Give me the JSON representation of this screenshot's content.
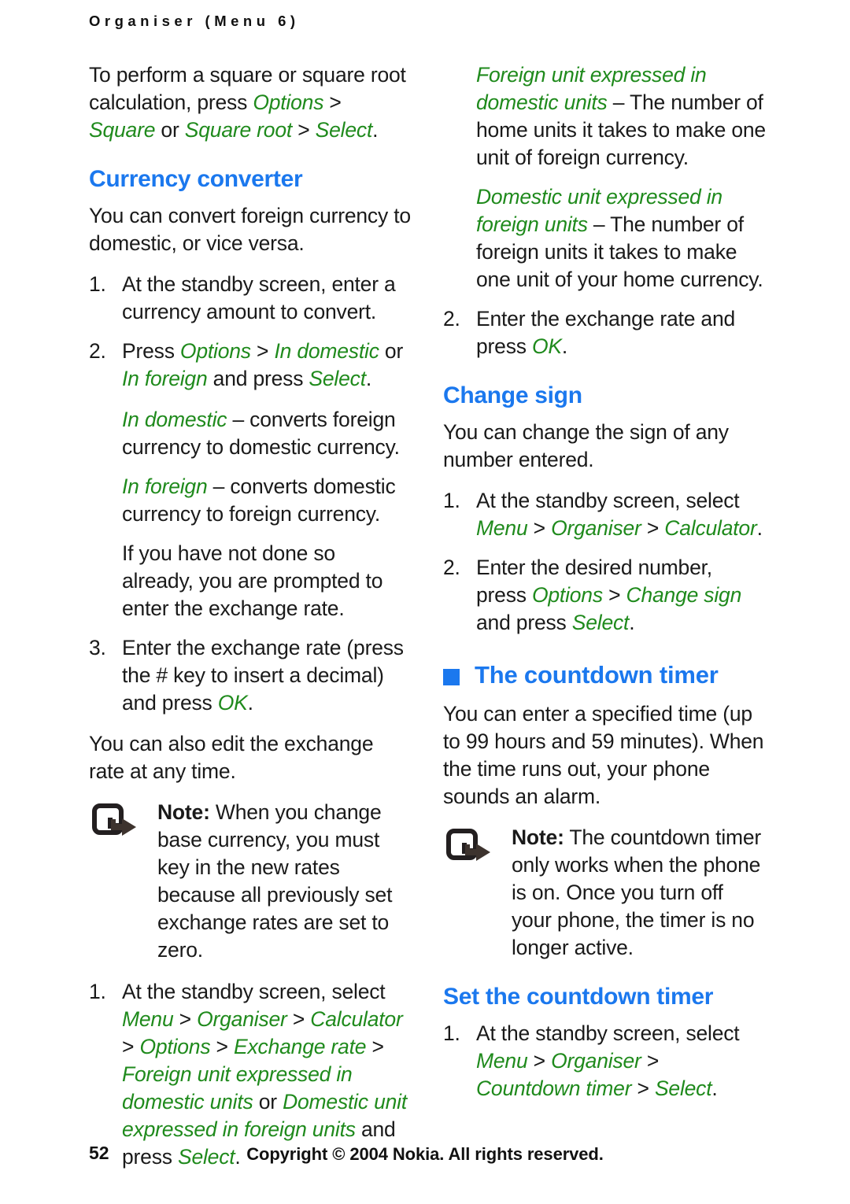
{
  "header": {
    "running_title": "Organiser (Menu 6)"
  },
  "colors": {
    "heading_blue": "#1b78ee",
    "ui_term_green": "#1f8a1c",
    "body_black": "#1a1a1a"
  },
  "left_column": {
    "intro_paragraph": {
      "t1": "To perform a square or square root calculation, press ",
      "ui1": "Options",
      "sep1": " > ",
      "ui2": "Square",
      "t2": " or ",
      "ui3": "Square root",
      "sep2": " > ",
      "ui4": "Select",
      "t3": "."
    },
    "currency_heading": "Currency converter",
    "currency_intro": "You can convert foreign currency to domestic, or vice versa.",
    "steps": {
      "s1_num": "1.",
      "s1_text": "At the standby screen, enter a currency amount to convert.",
      "s2_num": "2.",
      "s2_a": "Press ",
      "s2_ui1": "Options",
      "s2_sep1": " > ",
      "s2_ui2": "In domestic",
      "s2_b": " or ",
      "s2_ui3": "In foreign",
      "s2_c": " and press ",
      "s2_ui4": "Select",
      "s2_d": ".",
      "sub1_ui": "In domestic",
      "sub1_text": " – converts foreign currency to domestic currency.",
      "sub2_ui": "In foreign",
      "sub2_text": " – converts domestic currency to foreign currency.",
      "sub3_text": "If you have not done so already, you are prompted to enter the exchange rate.",
      "s3_num": "3.",
      "s3_a": "Enter the exchange rate (press the # key to insert a decimal) and press ",
      "s3_ui1": "OK",
      "s3_b": "."
    },
    "edit_rate_paragraph": "You can also edit the exchange rate at any time.",
    "note": {
      "icon": "note-pointer-icon",
      "label": "Note:",
      "text": " When you change base currency, you must key in the new rates because all previously set exchange rates are set to zero."
    },
    "exchange_steps": {
      "s1_num": "1.",
      "s1_a": "At the standby screen, select ",
      "s1_ui1": "Menu",
      "s1_sep1": " > ",
      "s1_ui2": "Organiser",
      "s1_sep2": " > ",
      "s1_ui3": "Calculator",
      "s1_sep3": " > ",
      "s1_ui4": "Options",
      "s1_sep4": " > ",
      "s1_ui5": "Exchange rate",
      "s1_sep5": " > ",
      "s1_ui6": "Foreign unit expressed in domestic units",
      "s1_b": " or ",
      "s1_ui7": "Domestic unit expressed in foreign units",
      "s1_c": " and press ",
      "s1_ui8": "Select",
      "s1_d": "."
    }
  },
  "right_column": {
    "def1_ui": "Foreign unit expressed in domestic units",
    "def1_text": " – The number of home units it takes to make one unit of foreign currency.",
    "def2_ui": "Domestic unit expressed in foreign units",
    "def2_text": " – The number of foreign units it takes to make one unit of your home currency.",
    "step2": {
      "num": "2.",
      "a": "Enter the exchange rate and press ",
      "ui1": "OK",
      "b": "."
    },
    "change_sign_heading": "Change sign",
    "change_sign_intro": "You can change the sign of any number entered.",
    "change_sign_steps": {
      "s1_num": "1.",
      "s1_a": "At the standby screen, select ",
      "s1_ui1": "Menu",
      "s1_sep1": " > ",
      "s1_ui2": "Organiser",
      "s1_sep2": " > ",
      "s1_ui3": "Calculator",
      "s1_b": ".",
      "s2_num": "2.",
      "s2_a": "Enter the desired number, press ",
      "s2_ui1": "Options",
      "s2_sep1": " > ",
      "s2_ui2": "Change sign",
      "s2_b": " and press ",
      "s2_ui3": "Select",
      "s2_c": "."
    },
    "countdown_heading": "The countdown timer",
    "countdown_bullet": "blue-square-bullet",
    "countdown_intro": "You can enter a specified time (up to 99 hours and 59 minutes). When the time runs out, your phone sounds an alarm.",
    "note": {
      "icon": "note-pointer-icon",
      "label": "Note:",
      "text": " The countdown timer only works when the phone is on. Once you turn off your phone, the timer is no longer active."
    },
    "set_timer_heading": "Set the countdown timer",
    "set_timer_steps": {
      "s1_num": "1.",
      "s1_a": "At the standby screen, select ",
      "s1_ui1": "Menu",
      "s1_sep1": " > ",
      "s1_ui2": "Organiser",
      "s1_sep2": " > ",
      "s1_ui3": "Countdown timer",
      "s1_sep3": " > ",
      "s1_ui4": "Select",
      "s1_b": "."
    }
  },
  "footer": {
    "page_number": "52",
    "copyright": "Copyright © 2004 Nokia. All rights reserved."
  }
}
